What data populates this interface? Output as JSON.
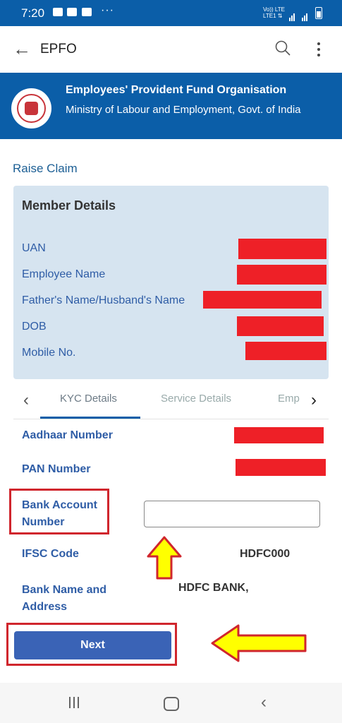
{
  "status_bar": {
    "time": "7:20",
    "dots": "···",
    "network": "Vo)) LTE\nLTE1 ⇅",
    "bg": "#0b5ea8"
  },
  "app_bar": {
    "title": "EPFO"
  },
  "banner": {
    "org_name": "Employees' Provident Fund Organisation",
    "ministry": "Ministry of Labour and Employment, Govt. of India"
  },
  "section_title": "Raise Claim",
  "member_details": {
    "title": "Member Details",
    "fields": [
      {
        "label": "UAN"
      },
      {
        "label": "Employee Name"
      },
      {
        "label": "Father's Name/Husband's Name"
      },
      {
        "label": "DOB"
      },
      {
        "label": "Mobile No."
      }
    ]
  },
  "tabs": {
    "items": [
      "KYC Details",
      "Service Details",
      "Emp"
    ],
    "active": "KYC Details"
  },
  "kyc": {
    "aadhaar_label": "Aadhaar Number",
    "pan_label": "PAN Number",
    "bank_account_label": "Bank Account Number",
    "bank_account_value": "",
    "ifsc_label": "IFSC Code",
    "ifsc_value": "HDFC000",
    "bank_name_label": "Bank Name and Address",
    "bank_name_value": "HDFC BANK,"
  },
  "next_button": "Next",
  "colors": {
    "brand": "#0b5ea8",
    "label": "#2f5da6",
    "redaction": "#ee2027",
    "highlight": "#d0262d",
    "arrow_fill": "#ffff00"
  }
}
